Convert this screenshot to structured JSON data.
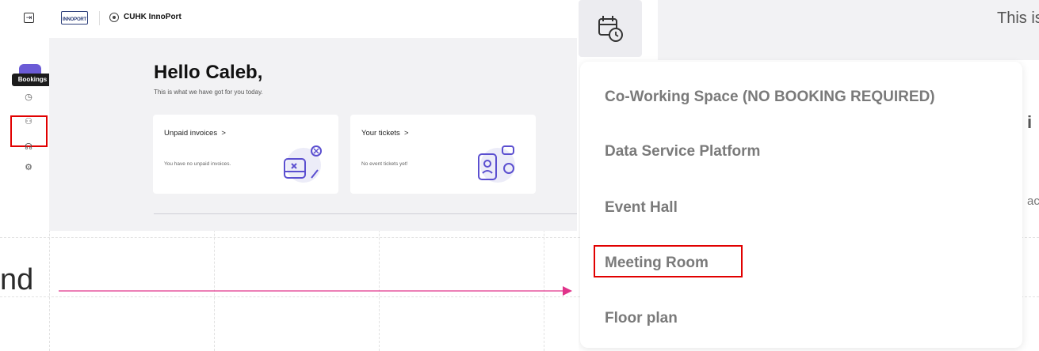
{
  "topbar": {
    "logo_text": "INNOPORT",
    "site_name": "CUHK InnoPort",
    "collapse_glyph": "⇥"
  },
  "sidebar": {
    "tooltip": "Bookings",
    "items": [
      {
        "icon": "calendar-clock-icon",
        "glyph": "◷"
      },
      {
        "icon": "people-icon",
        "glyph": "⚇"
      },
      {
        "icon": "headset-icon",
        "glyph": "☊"
      },
      {
        "icon": "gear-icon",
        "glyph": "⚙"
      }
    ]
  },
  "main": {
    "greeting": "Hello Caleb,",
    "subtitle": "This is what we have got for you today.",
    "cards": [
      {
        "title": "Unpaid invoices",
        "chevron": ">",
        "text": "You have no unpaid invoices."
      },
      {
        "title": "Your tickets",
        "chevron": ">",
        "text": "No event tickets yet!"
      }
    ]
  },
  "annotation": {
    "text": "nd"
  },
  "zoom": {
    "header_text": "This is what",
    "peek_right_1": "i",
    "peek_right_2": "ac",
    "menu": [
      "Co-Working Space (NO BOOKING REQUIRED)",
      "Data Service Platform",
      "Event Hall",
      "Meeting Room",
      "Floor plan"
    ]
  },
  "colors": {
    "accent": "#6b5bd6",
    "highlight": "#e10000",
    "arrow": "#e0338a"
  }
}
